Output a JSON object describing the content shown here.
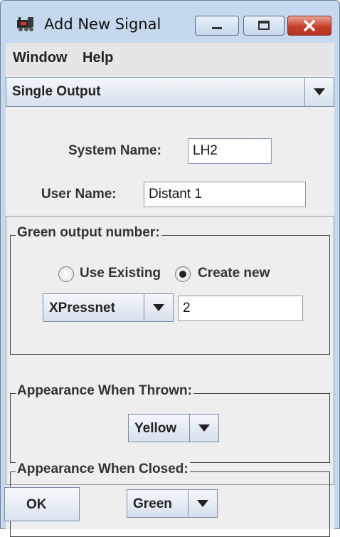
{
  "window": {
    "title": "Add New Signal"
  },
  "menubar": {
    "items": [
      "Window",
      "Help"
    ]
  },
  "signal_type": {
    "selected": "Single Output"
  },
  "system_name": {
    "label": "System Name:",
    "value": "LH2"
  },
  "user_name": {
    "label": "User Name:",
    "value": "Distant 1"
  },
  "green_output": {
    "title": "Green output number:",
    "use_existing_label": "Use Existing",
    "create_new_label": "Create new",
    "selected_option": "Create new",
    "system": "XPressnet",
    "number": "2"
  },
  "thrown": {
    "title": "Appearance When Thrown:",
    "selected": "Yellow"
  },
  "closed": {
    "title": "Appearance When Closed:",
    "selected": "Green"
  },
  "buttons": {
    "ok": "OK"
  },
  "colors": {
    "titlebar": "#c5d8ed",
    "close_button": "#c7402e",
    "panel": "#eeeeee"
  }
}
